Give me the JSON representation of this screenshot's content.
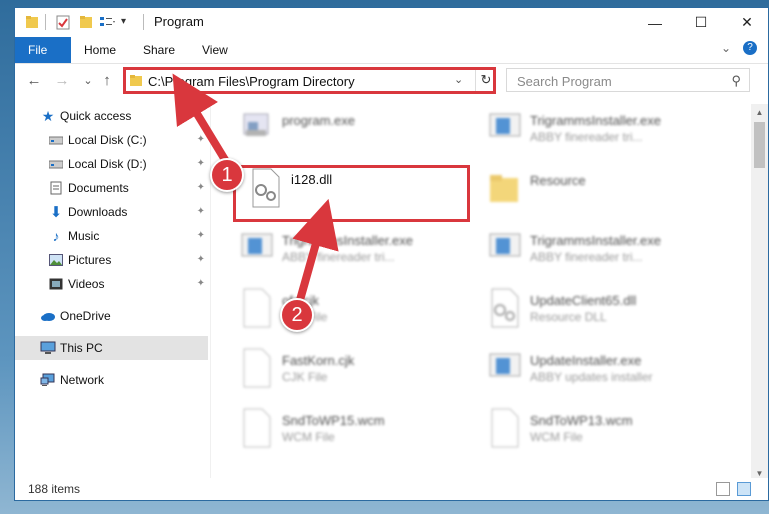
{
  "window": {
    "title": "Program",
    "controls": {
      "minimize": "—",
      "maximize": "☐",
      "close": "✕"
    }
  },
  "ribbon": {
    "tabs": [
      {
        "label": "File"
      },
      {
        "label": "Home"
      },
      {
        "label": "Share"
      },
      {
        "label": "View"
      }
    ],
    "expand_glyph": "⌄",
    "help_glyph": "?"
  },
  "navigation": {
    "back_glyph": "←",
    "forward_glyph": "→",
    "recent_glyph": "⌄",
    "up_glyph": "↑",
    "address": "C:\\Program Files\\Program Directory",
    "dropdown_glyph": "⌄",
    "refresh_glyph": "↻",
    "search_placeholder": "Search Program",
    "search_glyph": "⚲"
  },
  "sidebar": {
    "items": [
      {
        "label": "Quick access",
        "icon": "star-icon"
      },
      {
        "label": "Local Disk (C:)",
        "icon": "drive-icon"
      },
      {
        "label": "Local Disk (D:)",
        "icon": "drive-icon"
      },
      {
        "label": "Documents",
        "icon": "documents-icon"
      },
      {
        "label": "Downloads",
        "icon": "download-icon"
      },
      {
        "label": "Music",
        "icon": "music-icon"
      },
      {
        "label": "Pictures",
        "icon": "pictures-icon"
      },
      {
        "label": "Videos",
        "icon": "videos-icon"
      },
      {
        "label": "OneDrive",
        "icon": "cloud-icon"
      },
      {
        "label": "This PC",
        "icon": "computer-icon"
      },
      {
        "label": "Network",
        "icon": "network-icon"
      }
    ],
    "pin_glyph": "📌"
  },
  "files": [
    {
      "name": "program.exe",
      "type": ""
    },
    {
      "name": "TrigrammsInstaller.exe",
      "type": "ABBY finereader tri..."
    },
    {
      "name": "i128.dll",
      "type": ""
    },
    {
      "name": "Resource",
      "type": ""
    },
    {
      "name": "TrigrammsInstaller.exe",
      "type": "ABBY finereader tri..."
    },
    {
      "name": "TrigrammsInstaller.exe",
      "type": "ABBY finereader tri..."
    },
    {
      "name": "ofc.cjk",
      "type": "CJK File"
    },
    {
      "name": "UpdateClient65.dll",
      "type": "Resource DLL"
    },
    {
      "name": "FastKorn.cjk",
      "type": "CJK File"
    },
    {
      "name": "UpdateInstaller.exe",
      "type": "ABBY updates installer"
    },
    {
      "name": "SndToWP15.wcm",
      "type": "WCM File"
    },
    {
      "name": "SndToWP13.wcm",
      "type": "WCM File"
    }
  ],
  "status": {
    "item_count": "188 items"
  },
  "callouts": [
    {
      "number": "1"
    },
    {
      "number": "2"
    }
  ],
  "colors": {
    "accent": "#1a6fc6",
    "highlight": "#d9373d"
  }
}
